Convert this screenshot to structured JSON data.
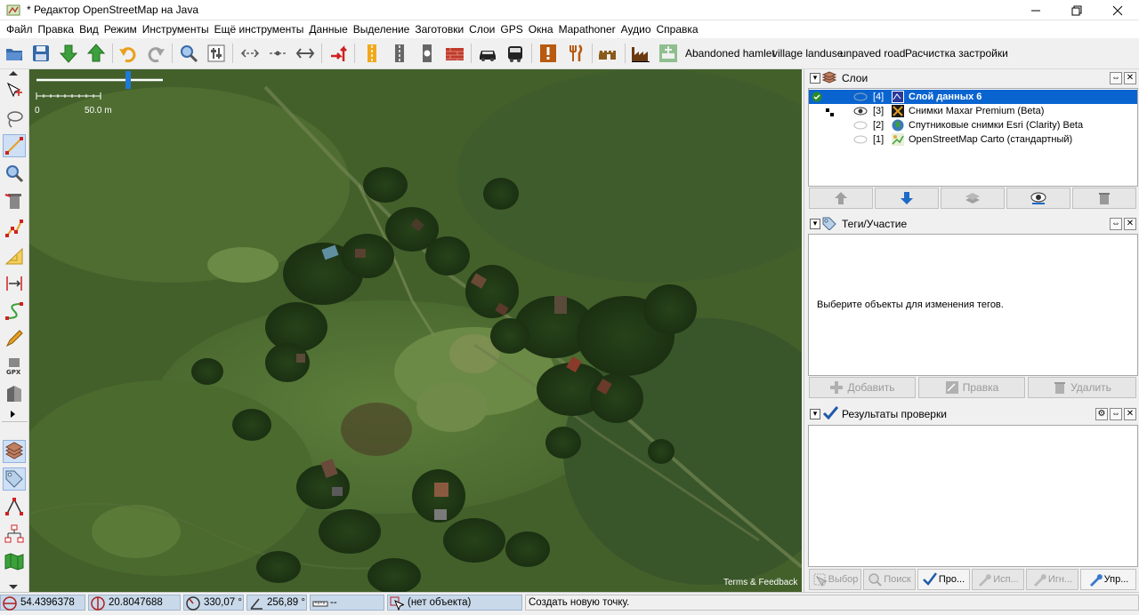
{
  "window": {
    "title": "* Редактор OpenStreetMap на Java"
  },
  "menu": [
    "Файл",
    "Правка",
    "Вид",
    "Режим",
    "Инструменты",
    "Ещё инструменты",
    "Данные",
    "Выделение",
    "Заготовки",
    "Слои",
    "GPS",
    "Окна",
    "Mapathoner",
    "Аудио",
    "Справка"
  ],
  "toolbar": {
    "presets": [
      "Abandoned hamlet",
      "village landuse",
      "unpaved road",
      "Расчистка застройки"
    ]
  },
  "map": {
    "scale_start": "0",
    "scale_label": "50.0 m",
    "attribution": "Terms & Feedback"
  },
  "layers_panel": {
    "title": "Слои",
    "layers": [
      {
        "index": "[4]",
        "name": "Слой данных 6",
        "active": true,
        "visible": false
      },
      {
        "index": "[3]",
        "name": "Снимки Maxar Premium (Beta)",
        "active": false,
        "visible": true
      },
      {
        "index": "[2]",
        "name": "Спутниковые снимки Esri (Clarity) Beta",
        "active": false,
        "visible": false
      },
      {
        "index": "[1]",
        "name": "OpenStreetMap Carto (стандартный)",
        "active": false,
        "visible": false
      }
    ]
  },
  "tags_panel": {
    "title": "Теги/Участие",
    "empty_message": "Выберите объекты для изменения тегов.",
    "add": "Добавить",
    "edit": "Правка",
    "delete": "Удалить"
  },
  "validation_panel": {
    "title": "Результаты проверки",
    "buttons": [
      "Выбор",
      "Поиск",
      "Про...",
      "Исп...",
      "Игн...",
      "Упр..."
    ]
  },
  "status": {
    "lat": "54.4396378",
    "lon": "20.8047688",
    "heading": "330,07 °",
    "angle": "256,89 °",
    "distance": "--",
    "object": "(нет объекта)",
    "message": "Создать новую точку."
  }
}
